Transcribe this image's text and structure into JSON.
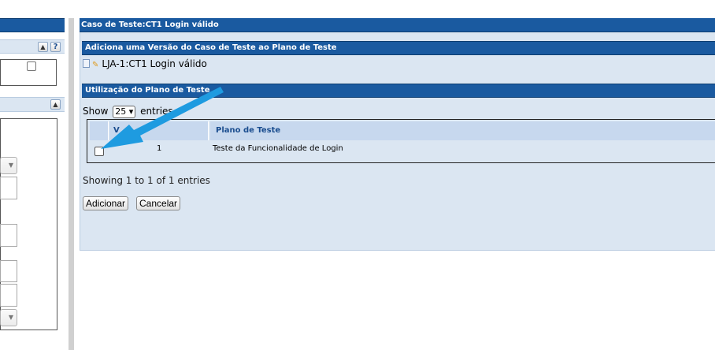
{
  "page": {
    "title": "Caso de Teste:CT1 Login válido"
  },
  "sidebar": {
    "collapse_symbol": "▲",
    "help_symbol": "?",
    "dropdown_arrow": "▼"
  },
  "add_version": {
    "header": "Adiciona uma Versão do Caso de Teste ao Plano de Teste",
    "test_case": "LJA-1:CT1 Login válido"
  },
  "usage": {
    "header": "Utilização do Plano de Teste",
    "show_prefix": "Show",
    "page_size": "25 ▾",
    "show_suffix": "entries",
    "columns": [
      "",
      "Versão",
      "Plano de Teste"
    ],
    "version_header_visible": "V",
    "rows": [
      {
        "checked": false,
        "version": "1",
        "plan": "Teste da Funcionalidade de Login"
      }
    ],
    "info": "Showing 1 to 1 of 1 entries"
  },
  "actions": {
    "add_label": "Adicionar",
    "cancel_label": "Cancelar"
  },
  "colors": {
    "header_blue": "#1a5aa0",
    "panel_bg": "#dbe6f2",
    "arrow": "#1e9be0"
  },
  "annotation": {
    "type": "arrow",
    "points_to": "row-checkbox"
  }
}
